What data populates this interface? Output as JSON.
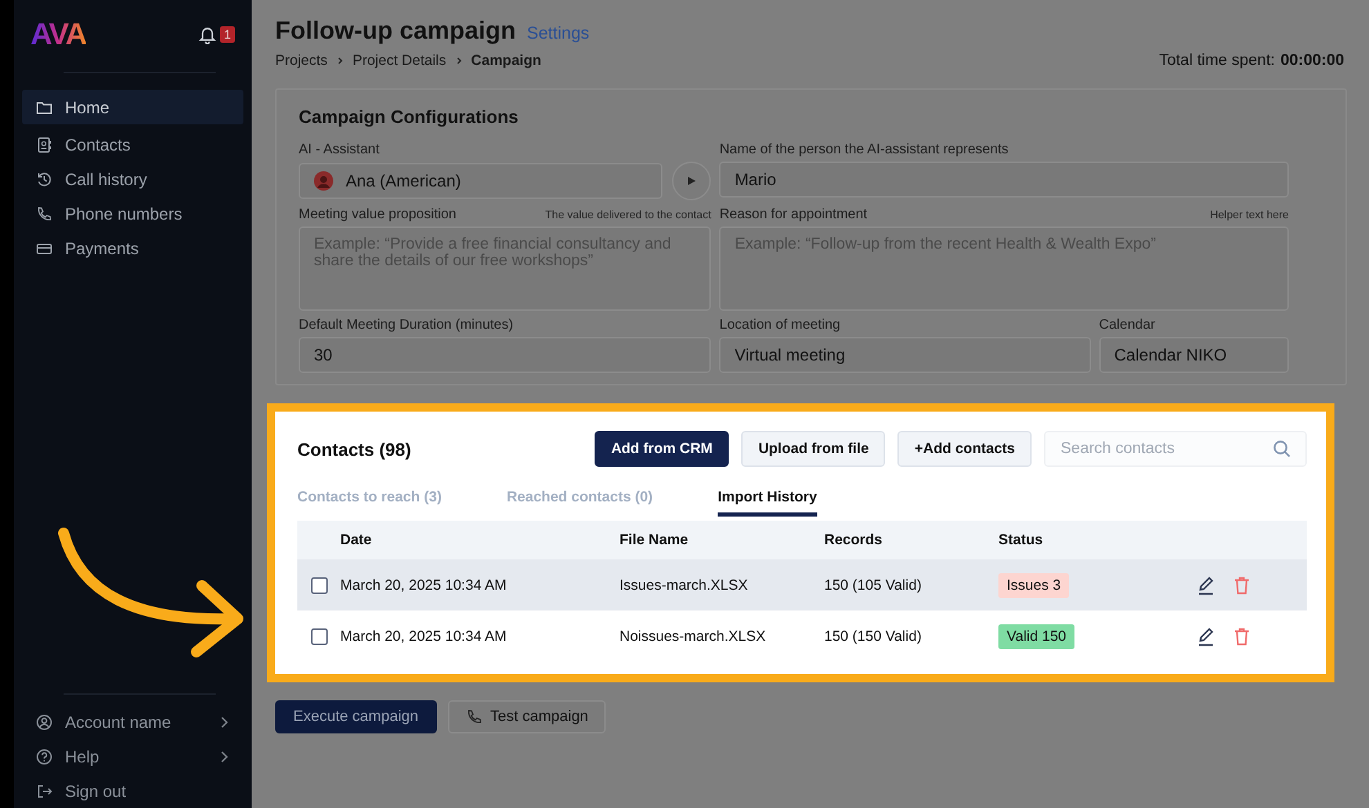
{
  "sidebar": {
    "logo": "AVA",
    "notification_count": "1",
    "nav_items": [
      {
        "label": "Home",
        "selected": true
      },
      {
        "label": "Contacts",
        "selected": false
      },
      {
        "label": "Call history",
        "selected": false
      },
      {
        "label": "Phone numbers",
        "selected": false
      },
      {
        "label": "Payments",
        "selected": false
      }
    ],
    "footer_items": [
      {
        "label": "Account name",
        "has_submenu": true
      },
      {
        "label": "Help",
        "has_submenu": true
      },
      {
        "label": "Sign out",
        "has_submenu": false
      }
    ]
  },
  "header": {
    "title": "Follow-up campaign",
    "settings_link": "Settings",
    "breadcrumbs": [
      "Projects",
      "Project Details",
      "Campaign"
    ],
    "time_label": "Total time spent:",
    "time_value": "00:00:00"
  },
  "config": {
    "title": "Campaign Configurations",
    "rows": [
      [
        {
          "kind": "voice-select",
          "label": "AI - Assistant",
          "value": "Ana (American)"
        },
        {
          "kind": "text",
          "label": "Name of the person the AI-assistant represents",
          "value": "Mario"
        }
      ],
      [
        {
          "kind": "textarea",
          "label": "Meeting value proposition",
          "helper": "The value delivered to the contact",
          "placeholder": "Example: “Provide a free financial consultancy and share the details of our free workshops”"
        },
        {
          "kind": "textarea",
          "label": "Reason for appointment",
          "helper": "Helper text here",
          "placeholder": "Example: “Follow-up from the recent Health & Wealth Expo”"
        }
      ],
      [
        {
          "kind": "text",
          "label": "Default Meeting Duration (minutes)",
          "value": "30"
        },
        {
          "kind": "text",
          "label": "Location of meeting",
          "value": "Virtual meeting"
        },
        {
          "kind": "text",
          "label": "Calendar",
          "value": "Calendar NIKO"
        }
      ]
    ]
  },
  "contacts": {
    "title": "Contacts (98)",
    "highlighted": true,
    "buttons": [
      {
        "label": "Add from CRM",
        "kind": "primary"
      },
      {
        "label": "Upload from file",
        "kind": "secondary"
      },
      {
        "label": "+Add contacts",
        "kind": "secondary"
      }
    ],
    "search": {
      "placeholder": "Search contacts"
    },
    "tabs": [
      {
        "label": "Contacts to reach (3)",
        "selected": false
      },
      {
        "label": "Reached contacts (0)",
        "selected": false
      },
      {
        "label": "Import History",
        "selected": true
      }
    ],
    "table": {
      "columns": [
        "Date",
        "File Name",
        "Records",
        "Status"
      ],
      "rows": [
        {
          "selected": true,
          "checked": false,
          "date": "March 20, 2025 10:34 AM",
          "file": "Issues-march.XLSX",
          "records": "150 (105 Valid)",
          "status": {
            "label": "Issues 3",
            "kind": "issues"
          }
        },
        {
          "selected": false,
          "checked": false,
          "date": "March 20, 2025 10:34 AM",
          "file": "Noissues-march.XLSX",
          "records": "150 (150 Valid)",
          "status": {
            "label": "Valid 150",
            "kind": "valid"
          }
        }
      ]
    }
  },
  "actions": [
    {
      "label": "Execute campaign",
      "kind": "primary"
    },
    {
      "label": "Test campaign",
      "kind": "secondary"
    }
  ]
}
